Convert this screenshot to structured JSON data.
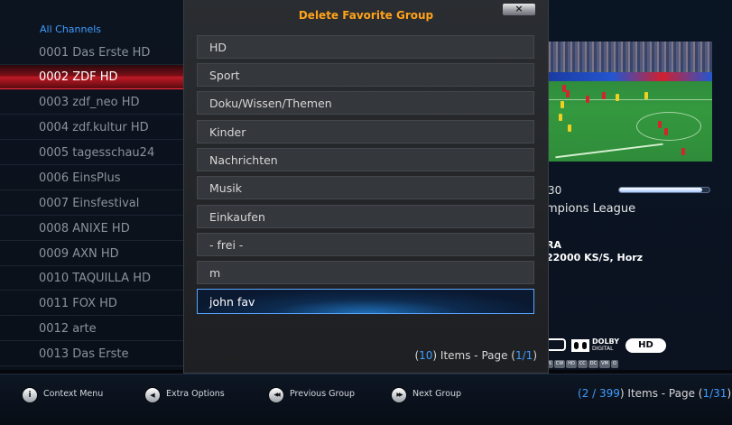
{
  "channel_list": {
    "header": "All Channels",
    "channels": [
      {
        "label": "0001 Das Erste HD",
        "selected": false
      },
      {
        "label": "0002 ZDF HD",
        "selected": true
      },
      {
        "label": "0003 zdf_neo HD",
        "selected": false
      },
      {
        "label": "0004 zdf.kultur HD",
        "selected": false
      },
      {
        "label": "0005 tagesschau24",
        "selected": false
      },
      {
        "label": "0006 EinsPlus",
        "selected": false
      },
      {
        "label": "0007 Einsfestival",
        "selected": false
      },
      {
        "label": "0008 ANIXE HD",
        "selected": false
      },
      {
        "label": "0009 AXN HD",
        "selected": false
      },
      {
        "label": "0010 TAQUILLA HD",
        "selected": false
      },
      {
        "label": "0011 FOX HD",
        "selected": false
      },
      {
        "label": "0012 arte",
        "selected": false
      },
      {
        "label": "0013 Das Erste",
        "selected": false
      }
    ]
  },
  "dialog": {
    "title": "Delete Favorite Group",
    "close_label": "×",
    "groups": [
      {
        "label": "HD",
        "selected": false
      },
      {
        "label": "Sport",
        "selected": false
      },
      {
        "label": "Doku/Wissen/Themen",
        "selected": false
      },
      {
        "label": "Kinder",
        "selected": false
      },
      {
        "label": "Nachrichten",
        "selected": false
      },
      {
        "label": "Musik",
        "selected": false
      },
      {
        "label": "Einkaufen",
        "selected": false
      },
      {
        "label": "- frei -",
        "selected": false
      },
      {
        "label": "m",
        "selected": false
      },
      {
        "label": "john fav",
        "selected": true
      }
    ],
    "pagination": {
      "items": "10",
      "items_suffix": ") Items - Page (",
      "page": "1/1",
      "open": "(",
      "close": ")"
    }
  },
  "info_panel": {
    "time": "30",
    "progress_fraction": 0.92,
    "program_title": "mpions League",
    "sat_line1": "RA",
    "sat_line2": "22000 KS/S, Horz",
    "dolby_line1": "DOLBY",
    "dolby_line2": "DIGITAL",
    "hd_badge": "HD",
    "small_icons": [
      "N",
      "CW",
      "HD",
      "CC",
      "DC",
      "VM",
      "O"
    ]
  },
  "bottom_bar": {
    "hints": [
      {
        "icon": "info-icon",
        "glyph": "i",
        "label": "Context Menu"
      },
      {
        "icon": "left-arrow-icon",
        "glyph": "◀",
        "label": "Extra Options"
      },
      {
        "icon": "rewind-icon",
        "glyph": "◀◀",
        "label": "Previous Group"
      },
      {
        "icon": "fast-forward-icon",
        "glyph": "▶▶",
        "label": "Next Group"
      }
    ],
    "pagination": {
      "open": "(",
      "position": "2 / 399",
      "middle": ") Items - Page (",
      "page": "1/31",
      "close": ")"
    }
  },
  "colors": {
    "accent_blue": "#3f9dff",
    "title_orange": "#ffa21a",
    "selected_red": "#c01a24"
  }
}
